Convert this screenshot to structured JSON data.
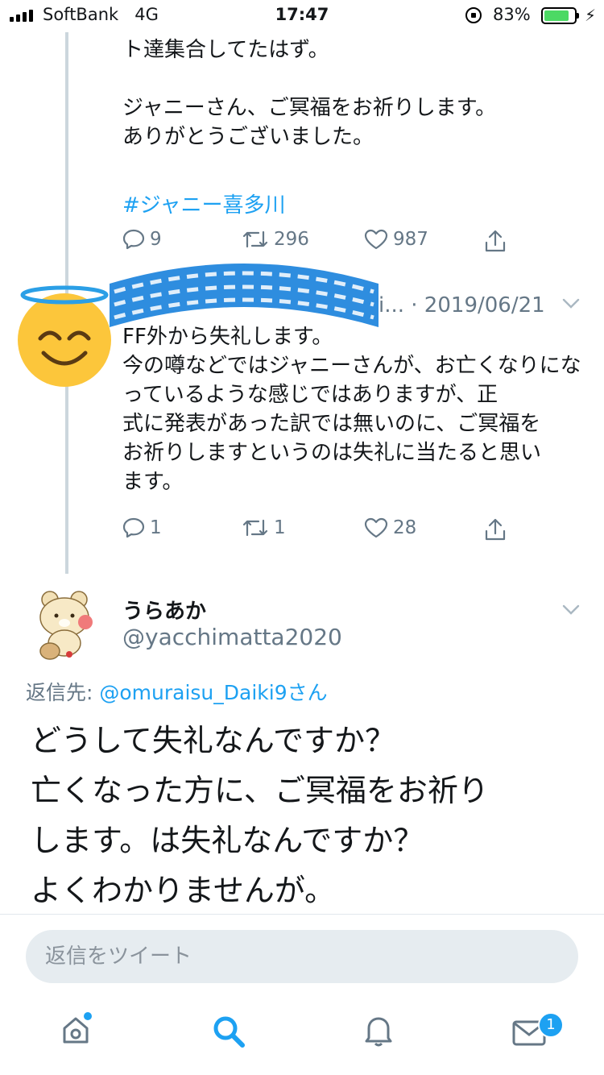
{
  "status_bar": {
    "carrier": "SoftBank   4G",
    "time": "17:47",
    "battery": "83%",
    "battery_level": 0.83
  },
  "prev_tweet": {
    "text": "ト達集合してたはず。\n\nジャニーさん、ご冥福をお祈りします。\nありがとうございました。",
    "hashtag": "#ジャニー喜多川",
    "replies": "9",
    "retweets": "296",
    "likes": "987"
  },
  "middle_tweet": {
    "meta": "i... · 2019/06/21",
    "text": "FF外から失礼します。\n今の噂などではジャニーさんが、お亡くなりになっているような感じではありますが、正\n式に発表があった訳では無いのに、ご冥福を\nお祈りしますというのは失礼に当たると思い\nます。",
    "replies": "1",
    "retweets": "1",
    "likes": "28"
  },
  "main_tweet": {
    "author_name": "うらあか",
    "author_handle": "@yacchimatta2020",
    "reply_to_label": "返信先: ",
    "reply_to_mention": "@omuraisu_Daiki9さん",
    "text": "どうして失礼なんですか？\n亡くなった方に、ご冥福をお祈り\nします。は失礼なんですか？\nよくわかりませんが。"
  },
  "reply_box": {
    "placeholder": "返信をツイート"
  },
  "tab_bar": {
    "tabs": [
      "home-icon",
      "search-icon",
      "notifications-icon",
      "messages-icon"
    ],
    "messages_badge": "1"
  },
  "colors": {
    "accent": "#1da1f2",
    "secondary_text": "#657786"
  }
}
